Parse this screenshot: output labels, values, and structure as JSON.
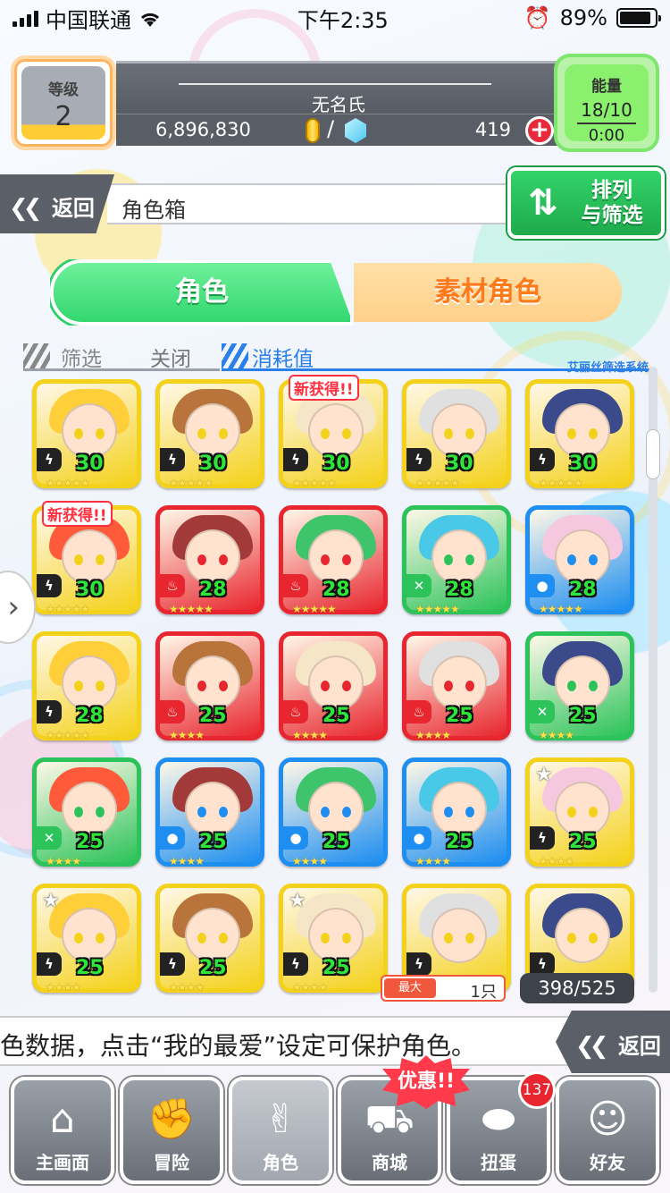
{
  "status_bar": {
    "carrier": "中国联通",
    "time": "下午2:35",
    "battery": "89%",
    "battery_level": 0.89
  },
  "header": {
    "level_label": "等级",
    "level_value": "2",
    "player_name": "无名氏",
    "coins": "6,896,830",
    "slash": "/",
    "gems": "419",
    "add_label": "+",
    "energy_label": "能量",
    "energy_value": "18/10",
    "energy_timer": "0:00"
  },
  "breadcrumb": {
    "back_label": "返回",
    "title": "角色箱",
    "sort_label_1": "排列",
    "sort_label_2": "与筛选"
  },
  "tabs": {
    "active": "角色",
    "inactive": "素材角色"
  },
  "filter": {
    "label": "筛选",
    "value": "关闭",
    "sort_value": "消耗值",
    "system_label": "艾丽丝筛选系统"
  },
  "cards": [
    {
      "color": "yellow",
      "attr": "thunder",
      "cost": "30",
      "stars": "★★★★★",
      "new": "",
      "fav": false
    },
    {
      "color": "yellow",
      "attr": "thunder",
      "cost": "30",
      "stars": "★★★★★",
      "new": "",
      "fav": false
    },
    {
      "color": "yellow",
      "attr": "thunder",
      "cost": "30",
      "stars": "★★★★★",
      "new": "新获得!!",
      "fav": false
    },
    {
      "color": "yellow",
      "attr": "thunder",
      "cost": "30",
      "stars": "★★★★★",
      "new": "",
      "fav": false
    },
    {
      "color": "yellow",
      "attr": "thunder",
      "cost": "30",
      "stars": "★★★★★",
      "new": "",
      "fav": false
    },
    {
      "color": "yellow",
      "attr": "thunder",
      "cost": "30",
      "stars": "★★★★★",
      "new": "新获得!!",
      "fav": false
    },
    {
      "color": "red",
      "attr": "fire",
      "cost": "28",
      "stars": "★★★★★",
      "new": "",
      "fav": false
    },
    {
      "color": "red",
      "attr": "fire",
      "cost": "28",
      "stars": "★★★★★",
      "new": "",
      "fav": false
    },
    {
      "color": "green",
      "attr": "wind",
      "cost": "28",
      "stars": "★★★★★",
      "new": "",
      "fav": false
    },
    {
      "color": "blue",
      "attr": "water",
      "cost": "28",
      "stars": "★★★★★",
      "new": "",
      "fav": false
    },
    {
      "color": "yellow",
      "attr": "thunder",
      "cost": "28",
      "stars": "★★★★★",
      "new": "",
      "fav": false
    },
    {
      "color": "red",
      "attr": "fire",
      "cost": "25",
      "stars": "★★★★",
      "new": "",
      "fav": false
    },
    {
      "color": "red",
      "attr": "fire",
      "cost": "25",
      "stars": "★★★★",
      "new": "",
      "fav": false
    },
    {
      "color": "red",
      "attr": "fire",
      "cost": "25",
      "stars": "★★★★",
      "new": "",
      "fav": false
    },
    {
      "color": "green",
      "attr": "wind",
      "cost": "25",
      "stars": "★★★★",
      "new": "",
      "fav": false
    },
    {
      "color": "green",
      "attr": "wind",
      "cost": "25",
      "stars": "★★★★",
      "new": "",
      "fav": false
    },
    {
      "color": "blue",
      "attr": "water",
      "cost": "25",
      "stars": "★★★★",
      "new": "",
      "fav": false
    },
    {
      "color": "blue",
      "attr": "water",
      "cost": "25",
      "stars": "★★★★",
      "new": "",
      "fav": false
    },
    {
      "color": "blue",
      "attr": "water",
      "cost": "25",
      "stars": "★★★★",
      "new": "",
      "fav": false
    },
    {
      "color": "yellow",
      "attr": "thunder",
      "cost": "25",
      "stars": "★★★★",
      "new": "",
      "fav": true
    },
    {
      "color": "yellow",
      "attr": "thunder",
      "cost": "25",
      "stars": "★★★★",
      "new": "",
      "fav": true
    },
    {
      "color": "yellow",
      "attr": "thunder",
      "cost": "25",
      "stars": "★★★★",
      "new": "",
      "fav": false
    },
    {
      "color": "yellow",
      "attr": "thunder",
      "cost": "25",
      "stars": "★★★★",
      "new": "",
      "fav": true
    },
    {
      "color": "yellow",
      "attr": "thunder",
      "cost": "",
      "stars": "",
      "new": "",
      "fav": false
    },
    {
      "color": "yellow",
      "attr": "thunder",
      "cost": "",
      "stars": "",
      "new": "",
      "fav": false
    }
  ],
  "counts": {
    "max_tag": "最大",
    "max_value": "1只",
    "box_count": "398/525"
  },
  "ticker": {
    "text": "色数据，点击“我的最爱”设定可保护角色。",
    "back_label": "返回"
  },
  "nav": {
    "items": [
      {
        "label": "主画面",
        "icon": "home-icon"
      },
      {
        "label": "冒险",
        "icon": "handshake-icon"
      },
      {
        "label": "角色",
        "icon": "rabbit-icon"
      },
      {
        "label": "商城",
        "icon": "cart-icon"
      },
      {
        "label": "扭蛋",
        "icon": "egg-icon"
      },
      {
        "label": "好友",
        "icon": "friends-icon"
      }
    ],
    "promo_label": "优惠!!",
    "notif_count": "137"
  },
  "colors": {
    "yellow": "#f4d21c",
    "red": "#e8262f",
    "green": "#2cc35a",
    "blue": "#1e8ef0",
    "accent_green": "#33d770",
    "accent_orange": "#ff7a1a",
    "accent_blue": "#2a7fe8"
  }
}
